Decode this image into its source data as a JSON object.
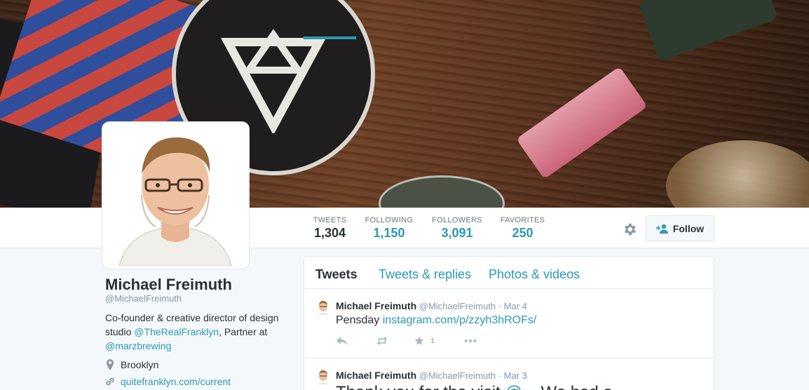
{
  "profile": {
    "name": "Michael Freimuth",
    "handle": "@MichaelFreimuth",
    "bio_prefix": "Co-founder & creative director of design studio ",
    "bio_link1": "@TheRealFranklyn",
    "bio_mid": ", Partner at ",
    "bio_link2": "@marzbrewing",
    "location": "Brooklyn",
    "url": "quitefranklyn.com/current"
  },
  "stats": {
    "tweets_label": "TWEETS",
    "tweets_value": "1,304",
    "following_label": "FOLLOWING",
    "following_value": "1,150",
    "followers_label": "FOLLOWERS",
    "followers_value": "3,091",
    "favorites_label": "FAVORITES",
    "favorites_value": "250"
  },
  "actions": {
    "follow_label": "Follow"
  },
  "tabs": [
    "Tweets",
    "Tweets & replies",
    "Photos & videos"
  ],
  "tweets": [
    {
      "name": "Michael Freimuth",
      "handle": "@MichaelFreimuth",
      "date": "· Mar 4",
      "text_prefix": "Pensday ",
      "text_link": "instagram.com/p/zzyh3hROFs/",
      "fav_count": "1"
    },
    {
      "name": "Michael Freimuth",
      "handle": "@MichaelFreimuth",
      "date": "· Mar 3",
      "text_prefix": "Thank you for the visit ",
      "text_link": "@...",
      "text_suffix": " We had a ..."
    }
  ],
  "colors": {
    "accent": "#2b9ab2",
    "text": "#292f33",
    "muted": "#8899a6",
    "background": "#f5f8fa"
  },
  "icons": {
    "settings": "gear-icon",
    "follow": "add-user-icon",
    "location": "map-pin-icon",
    "link": "link-icon",
    "reply": "reply-icon",
    "retweet": "retweet-icon",
    "favorite": "star-icon",
    "more": "more-icon"
  }
}
